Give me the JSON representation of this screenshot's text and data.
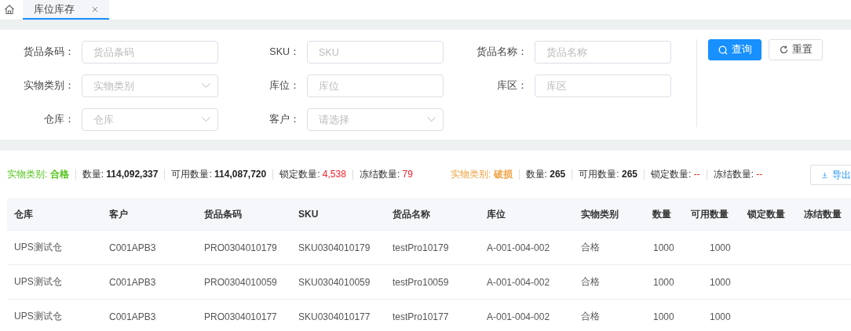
{
  "tabs": [
    {
      "label": "库位库存",
      "selected": true,
      "closable": true
    }
  ],
  "filters": [
    {
      "label": "货品条码：",
      "placeholder": "货品条码",
      "kind": "input"
    },
    {
      "label": "SKU：",
      "placeholder": "SKU",
      "kind": "input"
    },
    {
      "label": "货品名称：",
      "placeholder": "货品名称",
      "kind": "input"
    },
    {
      "label": "实物类别：",
      "placeholder": "实物类别",
      "kind": "select"
    },
    {
      "label": "库位：",
      "placeholder": "库位",
      "kind": "input"
    },
    {
      "label": "库区：",
      "placeholder": "库区",
      "kind": "input"
    },
    {
      "label": "仓库：",
      "placeholder": "仓库",
      "kind": "select"
    },
    {
      "label": "客户：",
      "placeholder": "请选择",
      "kind": "select"
    }
  ],
  "buttons": [
    {
      "label": "查询",
      "kind": "primary"
    },
    {
      "label": "重置",
      "kind": "default"
    }
  ],
  "summaries": [
    {
      "label": "实物类别:",
      "value": "合格",
      "color": "#52c41a",
      "stats": [
        {
          "label": "数量:",
          "value": "114,092,337",
          "kind": "plain"
        },
        {
          "label": "可用数量:",
          "value": "114,087,720",
          "kind": "plain"
        },
        {
          "label": "锁定数量:",
          "value": "4,538",
          "kind": "alert"
        },
        {
          "label": "冻结数量:",
          "value": "79",
          "kind": "alert"
        }
      ]
    },
    {
      "label": "实物类别:",
      "value": "破损",
      "color": "#f0a040",
      "stats": [
        {
          "label": "数量:",
          "value": "265",
          "kind": "plain"
        },
        {
          "label": "可用数量:",
          "value": "265",
          "kind": "plain"
        },
        {
          "label": "锁定数量:",
          "value": "--",
          "kind": "alert"
        },
        {
          "label": "冻结数量:",
          "value": "--",
          "kind": "alert"
        }
      ]
    }
  ],
  "export_button": "导出",
  "table": {
    "columns": [
      "仓库",
      "客户",
      "货品条码",
      "SKU",
      "货品名称",
      "库位",
      "实物类别",
      "数量",
      "可用数量",
      "锁定数量",
      "冻结数量"
    ],
    "rows": [
      [
        "UPS测试仓",
        "C001APB3",
        "PRO0304010179",
        "SKU0304010179",
        "testPro10179",
        "A-001-004-002",
        "合格",
        "1000",
        "1000"
      ],
      [
        "UPS测试仓",
        "C001APB3",
        "PRO0304010059",
        "SKU0304010059",
        "testPro10059",
        "A-001-004-002",
        "合格",
        "1000",
        "1000"
      ],
      [
        "UPS测试仓",
        "C001APB3",
        "PRO0304010177",
        "SKU0304010177",
        "testPro10177",
        "A-001-004-002",
        "合格",
        "1000",
        "1000"
      ]
    ]
  }
}
